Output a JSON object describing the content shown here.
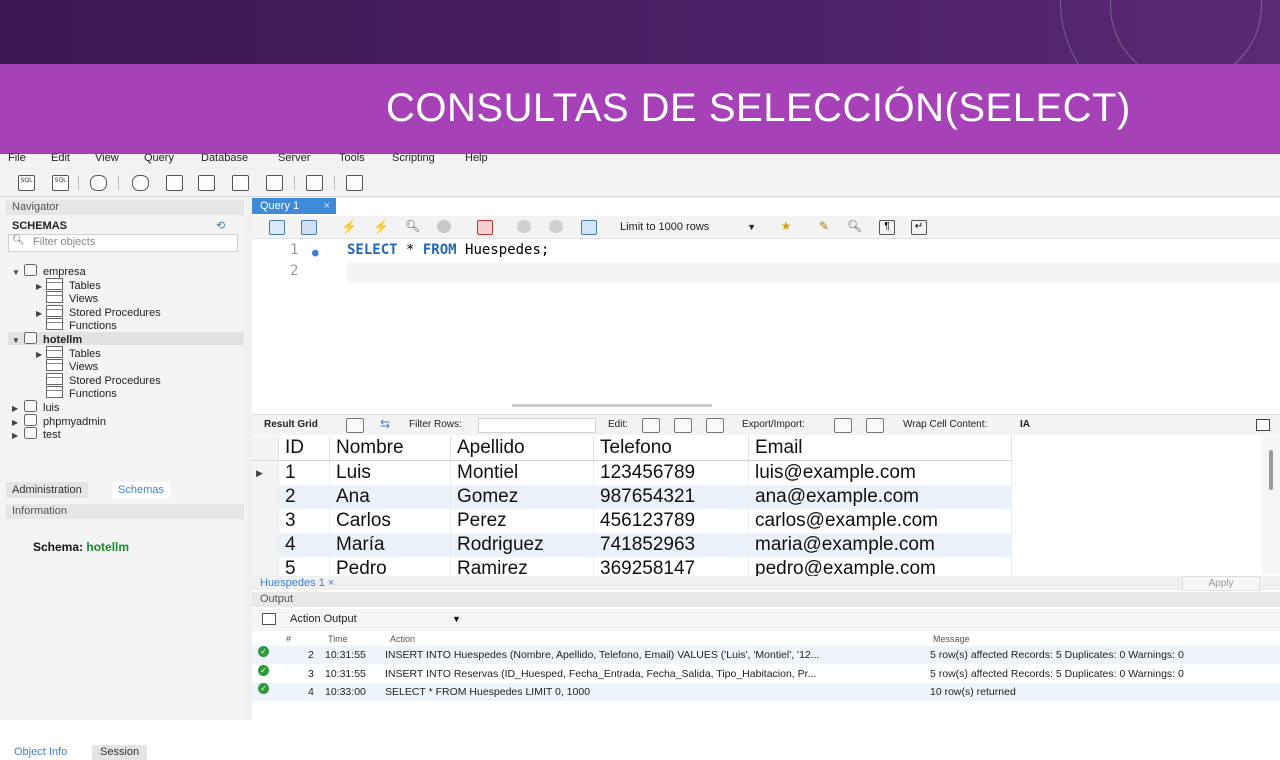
{
  "slide": {
    "title": "CONSULTAS DE SELECCIÓN(SELECT)"
  },
  "menu": [
    "File",
    "Edit",
    "View",
    "Query",
    "Database",
    "Server",
    "Tools",
    "Scripting",
    "Help"
  ],
  "navigator": {
    "header": "Navigator",
    "schemas_label": "SCHEMAS",
    "filter_placeholder": "Filter objects",
    "tree": [
      {
        "label": "empresa",
        "kind": "db",
        "level": 0,
        "arrow": "▼"
      },
      {
        "label": "Tables",
        "kind": "folder",
        "level": 1,
        "arrow": "▶"
      },
      {
        "label": "Views",
        "kind": "folder",
        "level": 1,
        "arrow": ""
      },
      {
        "label": "Stored Procedures",
        "kind": "folder",
        "level": 1,
        "arrow": "▶"
      },
      {
        "label": "Functions",
        "kind": "folder",
        "level": 1,
        "arrow": ""
      },
      {
        "label": "hotellm",
        "kind": "db",
        "level": 0,
        "arrow": "▼",
        "selected": true
      },
      {
        "label": "Tables",
        "kind": "folder",
        "level": 1,
        "arrow": "▶"
      },
      {
        "label": "Views",
        "kind": "folder",
        "level": 1,
        "arrow": ""
      },
      {
        "label": "Stored Procedures",
        "kind": "folder",
        "level": 1,
        "arrow": ""
      },
      {
        "label": "Functions",
        "kind": "folder",
        "level": 1,
        "arrow": ""
      },
      {
        "label": "luis",
        "kind": "db",
        "level": 0,
        "arrow": "▶"
      },
      {
        "label": "phpmyadmin",
        "kind": "db",
        "level": 0,
        "arrow": "▶"
      },
      {
        "label": "test",
        "kind": "db",
        "level": 0,
        "arrow": "▶"
      }
    ],
    "tabs": [
      "Administration",
      "Schemas"
    ],
    "information_header": "Information",
    "schema_label": "Schema:",
    "schema_value": "hotellm",
    "bottom_tabs": [
      "Object Info",
      "Session"
    ]
  },
  "query_tab": {
    "label": "Query 1",
    "close": "×"
  },
  "query_toolbar": {
    "limit_label": "Limit to 1000 rows"
  },
  "editor": {
    "line_numbers": [
      "1",
      "2"
    ],
    "sql_kw1": "SELECT",
    "sql_mid": " * ",
    "sql_kw2": "FROM",
    "sql_rest": " Huespedes;"
  },
  "result_toolbar": {
    "result_grid": "Result Grid",
    "filter_rows": "Filter Rows:",
    "edit": "Edit:",
    "export_import": "Export/Import:",
    "wrap": "Wrap Cell Content:"
  },
  "result_grid": {
    "columns": [
      "ID",
      "Nombre",
      "Apellido",
      "Telefono",
      "Email"
    ],
    "rows": [
      [
        "1",
        "Luis",
        "Montiel",
        "123456789",
        "luis@example.com"
      ],
      [
        "2",
        "Ana",
        "Gomez",
        "987654321",
        "ana@example.com"
      ],
      [
        "3",
        "Carlos",
        "Perez",
        "456123789",
        "carlos@example.com"
      ],
      [
        "4",
        "María",
        "Rodriguez",
        "741852963",
        "maria@example.com"
      ],
      [
        "5",
        "Pedro",
        "Ramirez",
        "369258147",
        "pedro@example.com"
      ]
    ]
  },
  "result_tab": {
    "label": "Huespedes 1",
    "close": "×",
    "apply": "Apply"
  },
  "output": {
    "header": "Output",
    "selector": "Action Output",
    "columns": [
      "#",
      "Time",
      "Action",
      "Message"
    ],
    "rows": [
      {
        "num": "2",
        "time": "10:31:55",
        "action": "INSERT INTO Huespedes (Nombre, Apellido, Telefono, Email) VALUES ('Luis', 'Montiel', '12...",
        "message": "5 row(s) affected Records: 5  Duplicates: 0  Warnings: 0"
      },
      {
        "num": "3",
        "time": "10:31:55",
        "action": "INSERT INTO Reservas (ID_Huesped, Fecha_Entrada, Fecha_Salida, Tipo_Habitacion, Pr...",
        "message": "5 row(s) affected Records: 5  Duplicates: 0  Warnings: 0"
      },
      {
        "num": "4",
        "time": "10:33:00",
        "action": "SELECT * FROM Huespedes LIMIT 0, 1000",
        "message": "10 row(s) returned"
      }
    ]
  },
  "colors": {
    "title_band": "#a641b8",
    "top_band": "#3a1850",
    "query_tab": "#3f8ad9",
    "keyword": "#2467b5",
    "status_ok": "#2e9a3c"
  }
}
